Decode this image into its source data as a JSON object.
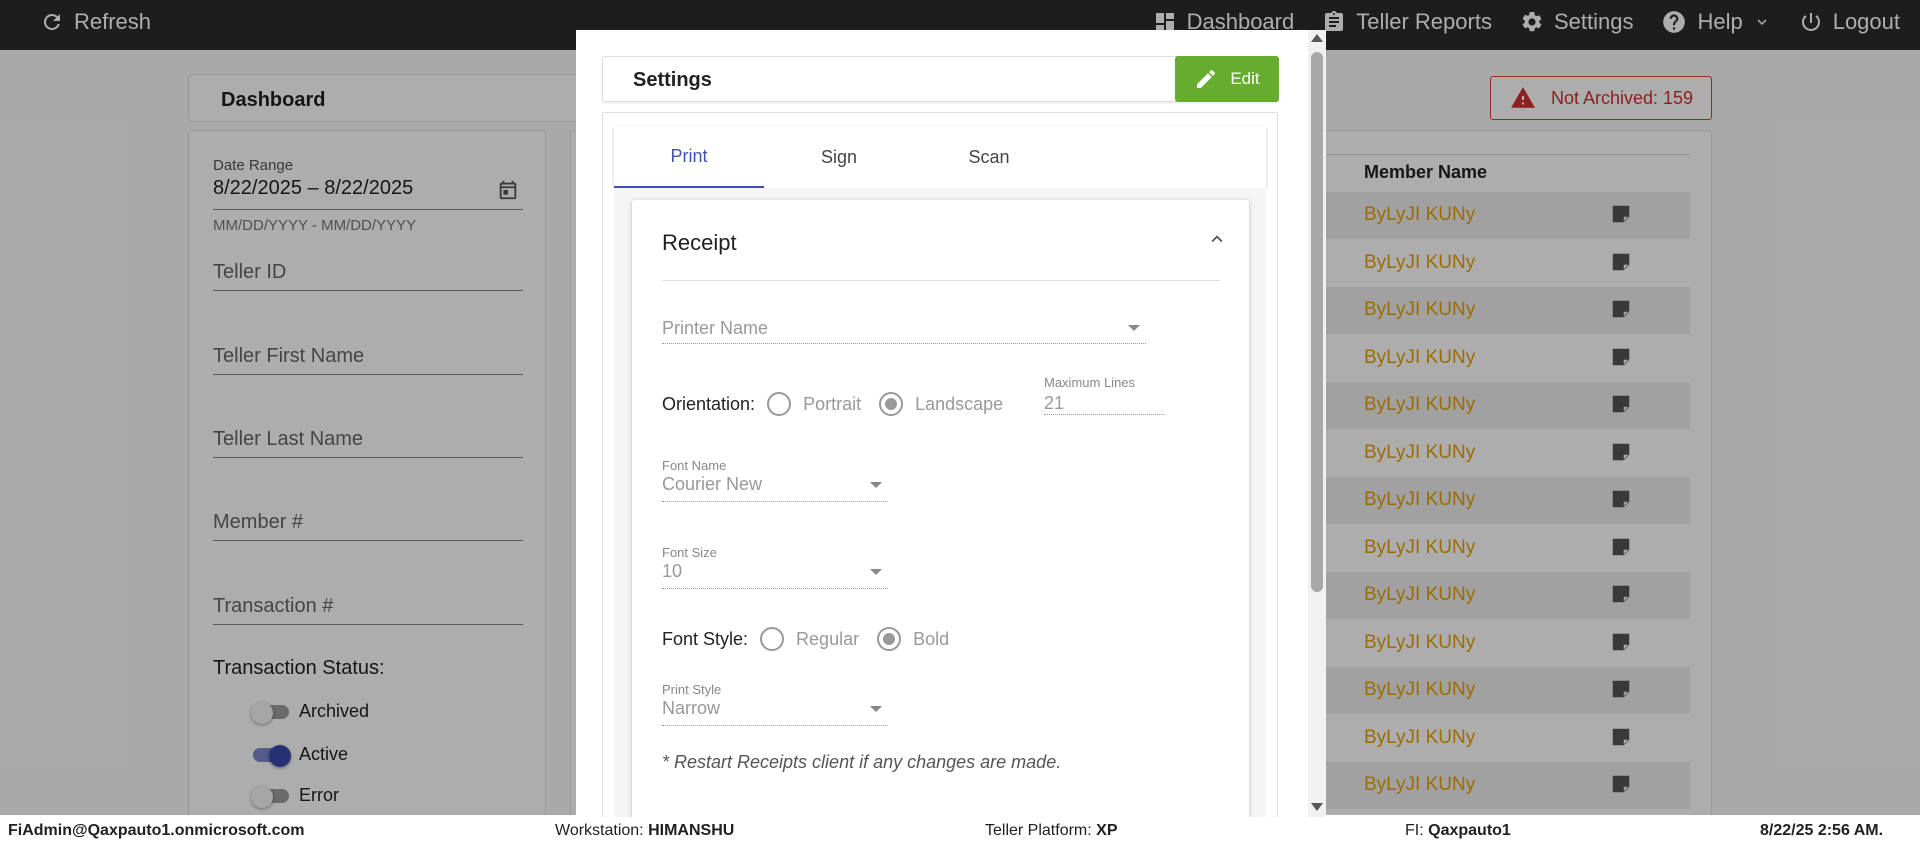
{
  "topbar": {
    "refresh_label": "Refresh",
    "nav": [
      {
        "label": "Dashboard",
        "icon": "dashboard-icon"
      },
      {
        "label": "Teller Reports",
        "icon": "clipboard-icon"
      },
      {
        "label": "Settings",
        "icon": "gear-icon"
      },
      {
        "label": "Help",
        "icon": "help-icon"
      },
      {
        "label": "Logout",
        "icon": "power-icon"
      }
    ]
  },
  "dashboard": {
    "title": "Dashboard",
    "not_archived": "Not Archived: 159",
    "filters": {
      "date_range_label": "Date Range",
      "date_range_value": "8/22/2025 – 8/22/2025",
      "date_range_hint": "MM/DD/YYYY - MM/DD/YYYY",
      "teller_id": "Teller ID",
      "teller_first_name": "Teller First Name",
      "teller_last_name": "Teller Last Name",
      "member_no": "Member #",
      "transaction_no": "Transaction #",
      "status_title": "Transaction Status:",
      "statuses": [
        {
          "label": "Archived",
          "on": false
        },
        {
          "label": "Active",
          "on": true
        },
        {
          "label": "Error",
          "on": false
        }
      ]
    },
    "table": {
      "member_header": "Member Name",
      "rows": [
        "ByLyJI KUNy",
        "ByLyJI KUNy",
        "ByLyJI KUNy",
        "ByLyJI KUNy",
        "ByLyJI KUNy",
        "ByLyJI KUNy",
        "ByLyJI KUNy",
        "ByLyJI KUNy",
        "ByLyJI KUNy",
        "ByLyJI KUNy",
        "ByLyJI KUNy",
        "ByLyJI KUNy",
        "ByLyJI KUNy"
      ]
    }
  },
  "modal": {
    "title": "Settings",
    "edit_label": "Edit",
    "tabs": [
      "Print",
      "Sign",
      "Scan"
    ],
    "active_tab": "Print",
    "receipt": {
      "title": "Receipt",
      "printer_name_placeholder": "Printer Name",
      "orientation_label": "Orientation:",
      "orientation_options": [
        "Portrait",
        "Landscape"
      ],
      "orientation_selected": "Landscape",
      "max_lines_label": "Maximum Lines",
      "max_lines_value": "21",
      "font_name_label": "Font Name",
      "font_name_value": "Courier New",
      "font_size_label": "Font Size",
      "font_size_value": "10",
      "font_style_label": "Font Style:",
      "font_style_options": [
        "Regular",
        "Bold"
      ],
      "font_style_selected": "Bold",
      "print_style_label": "Print Style",
      "print_style_value": "Narrow",
      "note": "* Restart Receipts client if any changes are made."
    }
  },
  "footer": {
    "user": "FiAdmin@Qaxpauto1.onmicrosoft.com",
    "workstation_label": "Workstation:",
    "workstation_value": "HIMANSHU",
    "platform_label": "Teller Platform:",
    "platform_value": "XP",
    "fi_label": "FI:",
    "fi_value": "Qaxpauto1",
    "datetime": "8/22/25 2:56 AM."
  },
  "colors": {
    "topbar": "#2b2b2b",
    "accent": "#3f51b5",
    "edit_button": "#66ad2f",
    "member_name": "#e8a000",
    "alert": "#d32f2f"
  }
}
